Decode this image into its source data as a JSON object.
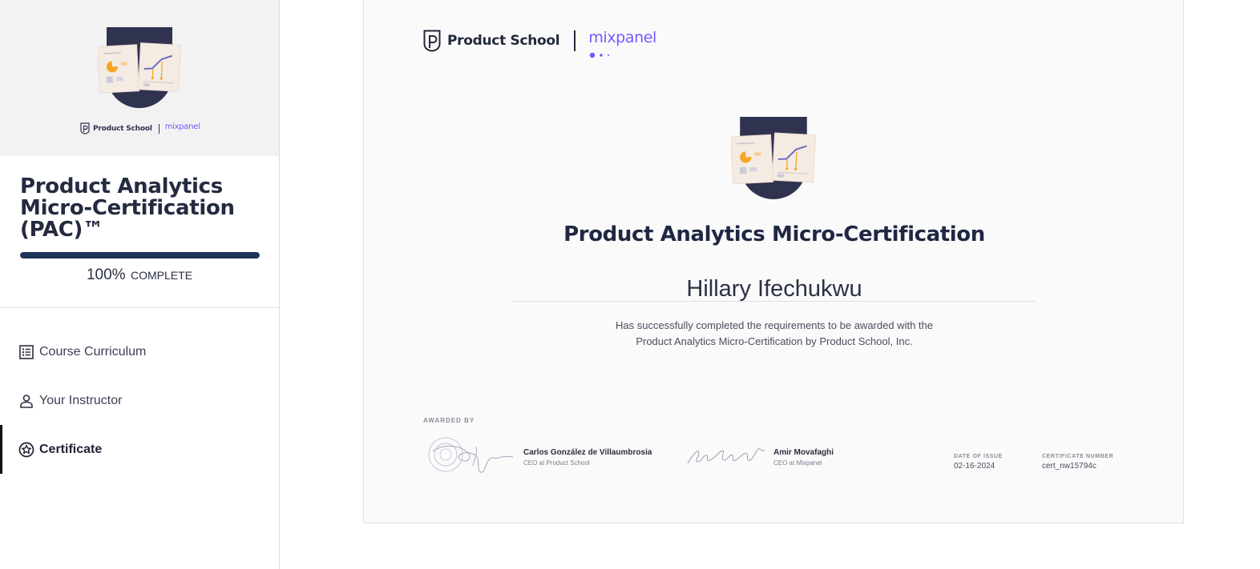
{
  "sidebar": {
    "logo": {
      "product_school": "Product School",
      "mixpanel": "mixpanel"
    },
    "course_title": "Product Analytics Micro-Certification (PAC)™",
    "progress": {
      "value_percent": 100,
      "percent_label": "100%",
      "label": "COMPLETE"
    },
    "nav_items": [
      {
        "label": "Course Curriculum",
        "icon": "list-icon",
        "active": false
      },
      {
        "label": "Your Instructor",
        "icon": "person-icon",
        "active": false
      },
      {
        "label": "Certificate",
        "icon": "badge-star-icon",
        "active": true
      }
    ]
  },
  "certificate": {
    "brand": {
      "product_school": "Product School",
      "mixpanel": "mixpanel"
    },
    "title": "Product Analytics Micro-Certification",
    "recipient": "Hillary Ifechukwu",
    "description_line1": "Has successfully completed the requirements to be awarded with the",
    "description_line2": "Product Analytics Micro-Certification by Product School, Inc.",
    "awarded_by_label": "AWARDED BY",
    "signers": [
      {
        "name": "Carlos González de Villaumbrosia",
        "role": "CEO at Product School"
      },
      {
        "name": "Amir Movafaghi",
        "role": "CEO at Mixpanel"
      }
    ],
    "date_of_issue": {
      "label": "DATE OF ISSUE",
      "value": "02-16-2024"
    },
    "certificate_number": {
      "label": "CERTIFICATE NUMBER",
      "value": "cert_nw15794c"
    }
  },
  "colors": {
    "navy": "#2f3350",
    "progress": "#1c3459",
    "mixpanel_purple": "#7856ff",
    "accent_orange": "#f5a623"
  }
}
